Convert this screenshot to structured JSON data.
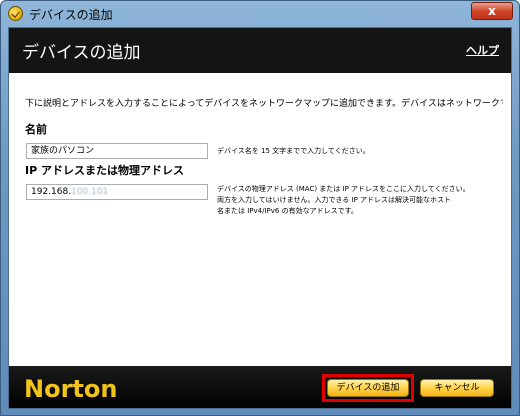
{
  "window": {
    "title": "デバイスの追加",
    "close_label": "x"
  },
  "header": {
    "title": "デバイスの追加",
    "help_label": "ヘルプ"
  },
  "body": {
    "description": "下に説明とアドレスを入力することによってデバイスをネットワークマップに追加できます。デバイスはネットワークマップに表示されます。",
    "name_label": "名前",
    "name_value": "家族のパソコン",
    "name_hint": "デバイス名を 15 文字までで入力してください。",
    "address_label": "IP アドレスまたは物理アドレス",
    "address_value_prefix": "192.168.",
    "address_value_masked": "100.101",
    "address_hint_1": "デバイスの物理アドレス (MAC) または IP アドレスをここに入力してください。",
    "address_hint_2": "両方を入力してはいけません。入力できる IP アドレスは解決可能なホスト",
    "address_hint_3": "名または IPv4/IPv6 の有効なアドレスです。"
  },
  "footer": {
    "logo_text": "Norton",
    "add_button": "デバイスの追加",
    "cancel_button": "キャンセル"
  },
  "colors": {
    "header_bg": "#141414",
    "button_gold": "#ffd24a",
    "highlight_red": "#e10000",
    "logo_gold": "#f0c419"
  }
}
